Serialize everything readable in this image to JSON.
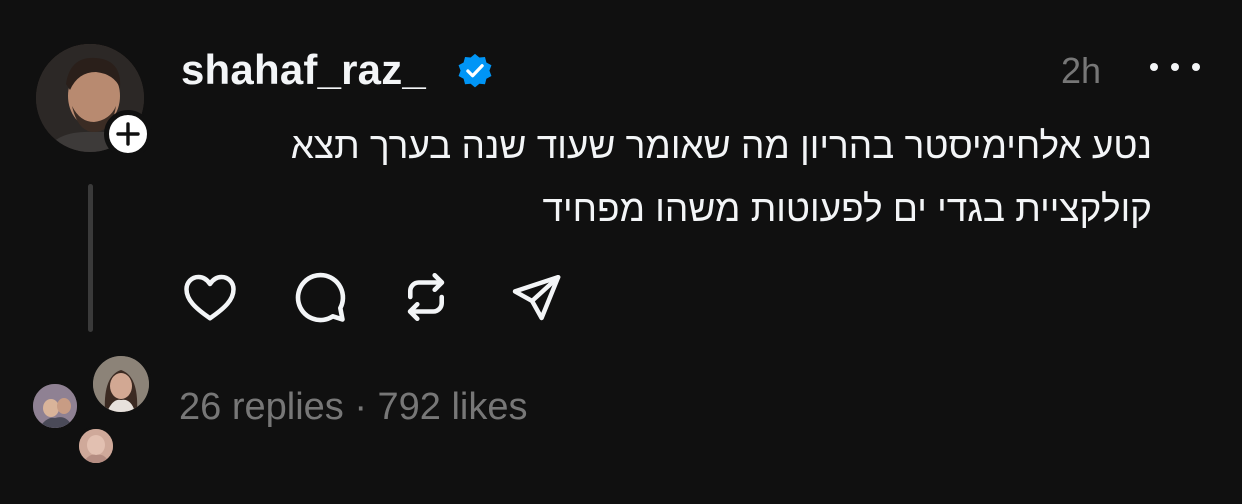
{
  "post": {
    "author": {
      "username": "shahaf_raz_",
      "verified": true,
      "avatar_icon": "profile-photo",
      "follow_icon": "plus-icon"
    },
    "timestamp": "2h",
    "more_icon": "more-horizontal-icon",
    "text_lines": [
      "נטע אלחימיסטר בהריון מה שאומר שעוד שנה בערך תצא",
      "קולקציית בגדי ים לפעוטות משהו מפחיד"
    ],
    "actions": {
      "like_icon": "heart-icon",
      "comment_icon": "comment-icon",
      "repost_icon": "repost-icon",
      "share_icon": "send-icon"
    },
    "stats": {
      "text": "26 replies · 792 likes"
    }
  },
  "colors": {
    "background": "#101010",
    "primary_text": "#f3f5f7",
    "secondary_text": "#777777",
    "verified_blue": "#0095f6",
    "thread_line": "#3a3a3a"
  }
}
